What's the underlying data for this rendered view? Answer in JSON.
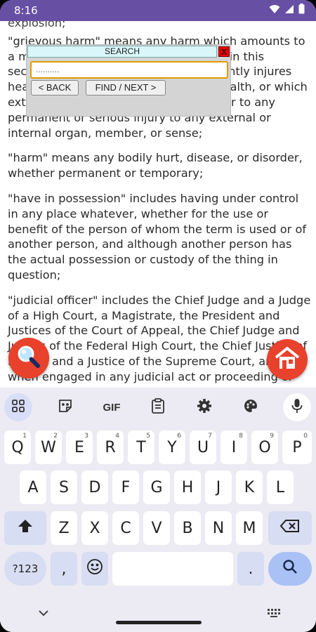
{
  "status_bar": {
    "time": "8:16"
  },
  "document": {
    "paragraphs": [
      "explosion;",
      "\"grievous harm\" means any harm which amounts to a maim or dangerous harm as defined in this section, or which seriously or permanently injures health, or which is likely so to injure health, or which extends to permanent disfigurement, or to any permanent or serious injury to any external or internal organ, member, or sense;",
      "\"harm\" means any bodily hurt, disease, or disorder, whether permanent or temporary;",
      "\"have in possession\" includes having under control in any place whatever, whether for the use or benefit of the person of whom the term is used or of another person, and although another person has the actual possession or custody of the thing in question;",
      "\"judicial officer\" includes the Chief Judge and a Judge of a High Court, a Magistrate, the President and Justices of the Court of Appeal, the Chief Judge and Judges of the Federal High Court, the Chief Justice of Nigeria and a Justice of the Supreme Court, and when engaged in any judicial act or proceeding or inquiry, an administrative officer;"
    ]
  },
  "search_dialog": {
    "title": "SEARCH",
    "close_label": "X",
    "input_value": "..........",
    "back_label": "< BACK",
    "next_label": "FIND / NEXT >"
  },
  "keyboard": {
    "toolbar": [
      "apps-icon",
      "sticker-icon",
      "GIF",
      "clipboard-icon",
      "settings-icon",
      "palette-icon",
      "mic-icon"
    ],
    "gif_label": "GIF",
    "row1": [
      "Q",
      "W",
      "E",
      "R",
      "T",
      "Y",
      "U",
      "I",
      "O",
      "P"
    ],
    "row1_hints": [
      "1",
      "2",
      "3",
      "4",
      "5",
      "6",
      "7",
      "8",
      "9",
      "0"
    ],
    "row2": [
      "A",
      "S",
      "D",
      "F",
      "G",
      "H",
      "J",
      "K",
      "L"
    ],
    "row3": [
      "Z",
      "X",
      "C",
      "V",
      "B",
      "N",
      "M"
    ],
    "sym_label": "?123",
    "comma_label": ",",
    "period_label": "."
  },
  "colors": {
    "status_bar": "#6750a4",
    "fab": "#e8412c",
    "search_title_bg": "#d9f7fb",
    "search_input_border": "#e09a00",
    "keyboard_bg": "#eceaf3",
    "enter_key": "#a9c1f5"
  }
}
